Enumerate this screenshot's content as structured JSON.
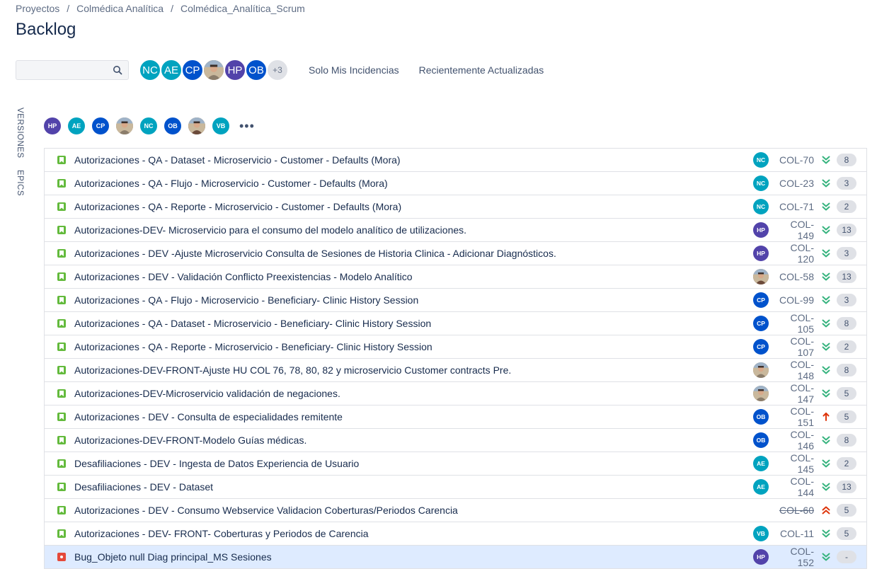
{
  "breadcrumb": [
    "Proyectos",
    "Colmédica Analítica",
    "Colmédica_Analítica_Scrum"
  ],
  "page_title": "Backlog",
  "search": {
    "value": "",
    "placeholder": ""
  },
  "header_avatars": [
    {
      "initials": "NC",
      "color": "#00a3bf",
      "photo": false
    },
    {
      "initials": "AE",
      "color": "#00a3bf",
      "photo": false
    },
    {
      "initials": "CP",
      "color": "#0052cc",
      "photo": false
    },
    {
      "initials": "",
      "color": "#8b7d6b",
      "photo": true
    },
    {
      "initials": "HP",
      "color": "#5243aa",
      "photo": false
    },
    {
      "initials": "OB",
      "color": "#0052cc",
      "photo": false
    }
  ],
  "more_count": "+3",
  "quick_filters": [
    "Solo Mis Incidencias",
    "Recientemente Actualizadas"
  ],
  "side_tabs": [
    "VERSIONES",
    "EPICS"
  ],
  "assignee_filter": [
    {
      "initials": "HP",
      "color": "#5243aa",
      "photo": false
    },
    {
      "initials": "AE",
      "color": "#00a3bf",
      "photo": false
    },
    {
      "initials": "CP",
      "color": "#0052cc",
      "photo": false
    },
    {
      "initials": "",
      "color": "#8b7d6b",
      "photo": true
    },
    {
      "initials": "NC",
      "color": "#00a3bf",
      "photo": false
    },
    {
      "initials": "OB",
      "color": "#0052cc",
      "photo": false
    },
    {
      "initials": "",
      "color": "#6b4a3a",
      "photo": true
    },
    {
      "initials": "VB",
      "color": "#00a3bf",
      "photo": false
    }
  ],
  "more_label": "•••",
  "issues": [
    {
      "type": "story",
      "summary": "Autorizaciones - QA - Dataset - Microservicio - Customer - Defaults (Mora)",
      "assignee": {
        "initials": "NC",
        "color": "#00a3bf",
        "photo": false
      },
      "key": "COL-70",
      "priority": "low",
      "points": "8",
      "done": false
    },
    {
      "type": "story",
      "summary": "Autorizaciones - QA - Flujo - Microservicio - Customer - Defaults (Mora)",
      "assignee": {
        "initials": "NC",
        "color": "#00a3bf",
        "photo": false
      },
      "key": "COL-23",
      "priority": "low",
      "points": "3",
      "done": false
    },
    {
      "type": "story",
      "summary": "Autorizaciones - QA - Reporte - Microservicio - Customer - Defaults (Mora)",
      "assignee": {
        "initials": "NC",
        "color": "#00a3bf",
        "photo": false
      },
      "key": "COL-71",
      "priority": "low",
      "points": "2",
      "done": false
    },
    {
      "type": "story",
      "summary": "Autorizaciones-DEV- Microservicio para el consumo del modelo analítico de utilizaciones.",
      "assignee": {
        "initials": "HP",
        "color": "#5243aa",
        "photo": false
      },
      "key": "COL-149",
      "priority": "low",
      "points": "13",
      "done": false
    },
    {
      "type": "story",
      "summary": "Autorizaciones - DEV -Ajuste Microservicio Consulta de Sesiones de Historia Clinica - Adicionar Diagnósticos.",
      "assignee": {
        "initials": "HP",
        "color": "#5243aa",
        "photo": false
      },
      "key": "COL-120",
      "priority": "low",
      "points": "3",
      "done": false
    },
    {
      "type": "story",
      "summary": "Autorizaciones - DEV - Validación Conflicto Preexistencias - Modelo Analítico",
      "assignee": {
        "initials": "",
        "color": "#6b4a3a",
        "photo": true
      },
      "key": "COL-58",
      "priority": "low",
      "points": "13",
      "done": false
    },
    {
      "type": "story",
      "summary": "Autorizaciones - QA - Flujo - Microservicio - Beneficiary- Clinic History Session",
      "assignee": {
        "initials": "CP",
        "color": "#0052cc",
        "photo": false
      },
      "key": "COL-99",
      "priority": "low",
      "points": "3",
      "done": false
    },
    {
      "type": "story",
      "summary": "Autorizaciones - QA - Dataset - Microservicio - Beneficiary- Clinic History Session",
      "assignee": {
        "initials": "CP",
        "color": "#0052cc",
        "photo": false
      },
      "key": "COL-105",
      "priority": "low",
      "points": "8",
      "done": false
    },
    {
      "type": "story",
      "summary": "Autorizaciones - QA - Reporte - Microservicio - Beneficiary- Clinic History Session",
      "assignee": {
        "initials": "CP",
        "color": "#0052cc",
        "photo": false
      },
      "key": "COL-107",
      "priority": "low",
      "points": "2",
      "done": false
    },
    {
      "type": "story",
      "summary": "Autorizaciones-DEV-FRONT-Ajuste HU COL 76, 78, 80, 82 y microservicio Customer contracts Pre.",
      "assignee": {
        "initials": "",
        "color": "#8b7d6b",
        "photo": true
      },
      "key": "COL-148",
      "priority": "low",
      "points": "8",
      "done": false
    },
    {
      "type": "story",
      "summary": "Autorizaciones-DEV-Microservicio validación de negaciones.",
      "assignee": {
        "initials": "",
        "color": "#8b7d6b",
        "photo": true
      },
      "key": "COL-147",
      "priority": "low",
      "points": "5",
      "done": false
    },
    {
      "type": "story",
      "summary": "Autorizaciones - DEV - Consulta de especialidades remitente",
      "assignee": {
        "initials": "OB",
        "color": "#0052cc",
        "photo": false
      },
      "key": "COL-151",
      "priority": "high",
      "points": "5",
      "done": false
    },
    {
      "type": "story",
      "summary": "Autorizaciones-DEV-FRONT-Modelo Guías médicas.",
      "assignee": {
        "initials": "OB",
        "color": "#0052cc",
        "photo": false
      },
      "key": "COL-146",
      "priority": "low",
      "points": "8",
      "done": false
    },
    {
      "type": "story",
      "summary": "Desafiliaciones - DEV - Ingesta de Datos Experiencia de Usuario",
      "assignee": {
        "initials": "AE",
        "color": "#00a3bf",
        "photo": false
      },
      "key": "COL-145",
      "priority": "low",
      "points": "2",
      "done": false
    },
    {
      "type": "story",
      "summary": "Desafiliaciones - DEV - Dataset",
      "assignee": {
        "initials": "AE",
        "color": "#00a3bf",
        "photo": false
      },
      "key": "COL-144",
      "priority": "low",
      "points": "13",
      "done": false
    },
    {
      "type": "story",
      "summary": "Autorizaciones - DEV - Consumo Webservice Validacion Coberturas/Periodos Carencia",
      "assignee": null,
      "key": "COL-60",
      "priority": "highest",
      "points": "5",
      "done": true
    },
    {
      "type": "story",
      "summary": "Autorizaciones - DEV- FRONT- Coberturas y Periodos de Carencia",
      "assignee": {
        "initials": "VB",
        "color": "#00a3bf",
        "photo": false
      },
      "key": "COL-11",
      "priority": "low",
      "points": "5",
      "done": false
    },
    {
      "type": "bug",
      "summary": "Bug_Objeto null Diag principal_MS Sesiones",
      "assignee": {
        "initials": "HP",
        "color": "#5243aa",
        "photo": false
      },
      "key": "COL-152",
      "priority": "low",
      "points": "-",
      "done": false,
      "selected": true
    }
  ]
}
